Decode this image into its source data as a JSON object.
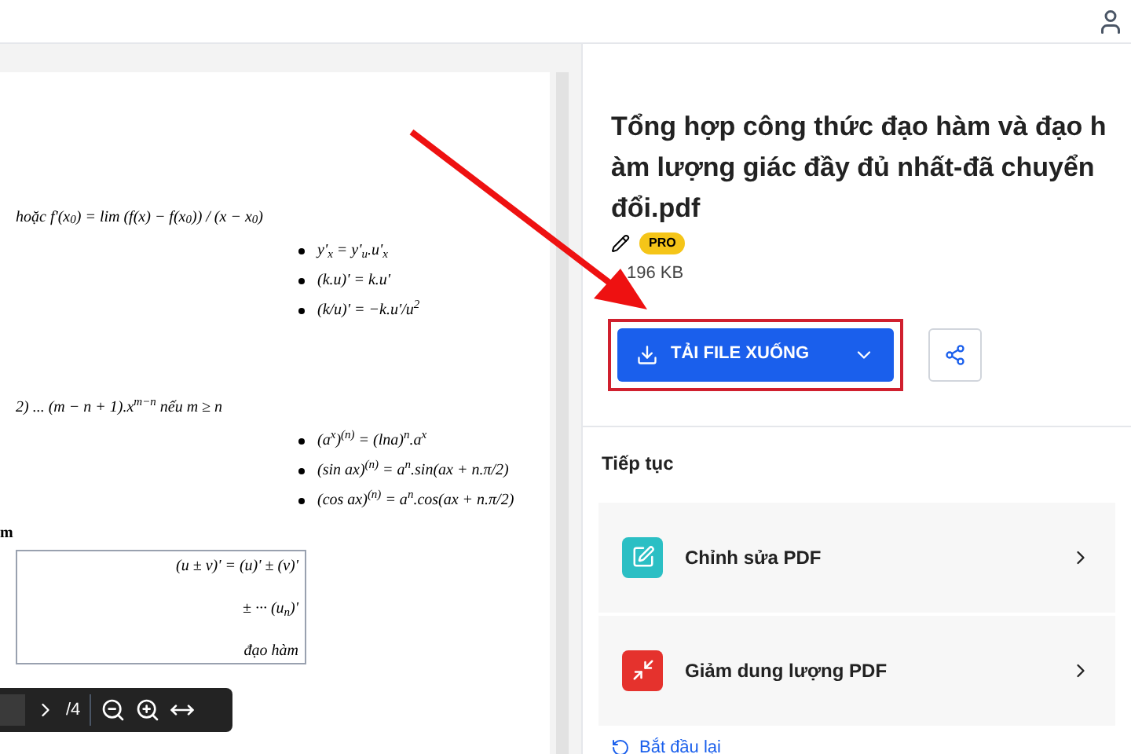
{
  "document": {
    "formulas": [
      {
        "kind": "line",
        "text": "hoặc f'(x$_{0}$) = lim (f(x) − f(x$_{0}$)) / (x − x$_{0}$)"
      },
      {
        "kind": "bullet",
        "text": "y'$_{x}$ = y'$_{u}$.u'$_{x}$"
      },
      {
        "kind": "bullet",
        "text": "(k.u)' = k.u'"
      },
      {
        "kind": "bullet",
        "text": "(k/u)' = −k.u'/u$^{2}$"
      },
      {
        "kind": "gap"
      },
      {
        "kind": "line",
        "text": "2) ... (m − n + 1).x$^{m−n}$ nếu m ≥ n"
      },
      {
        "kind": "bullet",
        "text": "(a$^{x}$)$^{(n)}$ = (lna)$^{n}$.a$^{x}$"
      },
      {
        "kind": "bullet",
        "text": "(sin ax)$^{(n)}$ = a$^{n}$.sin(ax + n.π/2)"
      },
      {
        "kind": "bullet",
        "text": "(cos ax)$^{(n)}$ = a$^{n}$.cos(ax + n.π/2)"
      },
      {
        "kind": "heading",
        "text": "m"
      }
    ],
    "table_cells": [
      "(u ± v)' = (u)' ± (v)'",
      "± ··· (u$_{n}$)'",
      "đạo hàm"
    ],
    "toolbar": {
      "page_total": "/4"
    }
  },
  "file": {
    "name": "Tổng hợp công thức đạo hàm và đạo h àm lượng giác đầy đủ nhất-đã chuyển đổi.pdf",
    "badge": "PRO",
    "size": "196 KB"
  },
  "download_button": {
    "label": "TẢI FILE XUỐNG"
  },
  "continue": {
    "title": "Tiếp tục",
    "actions": [
      {
        "label": "Chỉnh sửa PDF",
        "kind": "edit",
        "color": "#2bbfc4"
      },
      {
        "label": "Giảm dung lượng PDF",
        "kind": "compress",
        "color": "#e5322d"
      }
    ]
  },
  "restart_link": "Bắt đầu lại"
}
